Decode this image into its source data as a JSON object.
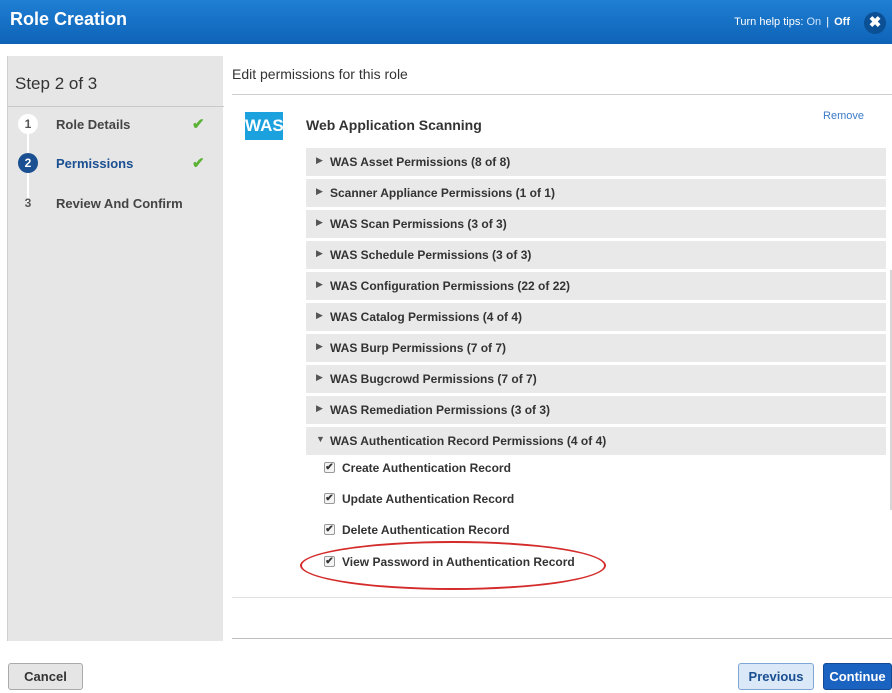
{
  "dialog": {
    "title": "Role Creation",
    "help_tips_label": "Turn help tips:",
    "help_on": "On",
    "help_separator": "|",
    "help_off": "Off",
    "close_glyph": "✖"
  },
  "steps_panel": {
    "header": "Step 2 of 3",
    "steps": [
      {
        "number": "1",
        "label": "Role Details",
        "status": "complete",
        "check": "✔"
      },
      {
        "number": "2",
        "label": "Permissions",
        "status": "current",
        "check": "✔"
      },
      {
        "number": "3",
        "label": "Review And Confirm",
        "status": "pending",
        "check": ""
      }
    ]
  },
  "main": {
    "heading": "Edit permissions for this role",
    "module": {
      "logo_text": "WAS",
      "title": "Web Application Scanning",
      "remove_label": "Remove"
    },
    "permission_groups": [
      {
        "label": "WAS Asset Permissions (8 of 8)",
        "expanded": false
      },
      {
        "label": "Scanner Appliance Permissions (1 of 1)",
        "expanded": false
      },
      {
        "label": "WAS Scan Permissions (3 of 3)",
        "expanded": false
      },
      {
        "label": "WAS Schedule Permissions (3 of 3)",
        "expanded": false
      },
      {
        "label": "WAS Configuration Permissions (22 of 22)",
        "expanded": false
      },
      {
        "label": "WAS Catalog Permissions (4 of 4)",
        "expanded": false
      },
      {
        "label": "WAS Burp Permissions (7 of 7)",
        "expanded": false
      },
      {
        "label": "WAS Bugcrowd Permissions (7 of 7)",
        "expanded": false
      },
      {
        "label": "WAS Remediation Permissions (3 of 3)",
        "expanded": false
      },
      {
        "label": "WAS Authentication Record Permissions (4 of 4)",
        "expanded": true
      }
    ],
    "collapsed_glyph": "▶",
    "expanded_glyph": "▼",
    "checkbox_glyph": "✔",
    "auth_record_permissions": [
      {
        "label": "Create Authentication Record",
        "checked": true
      },
      {
        "label": "Update Authentication Record",
        "checked": true
      },
      {
        "label": "Delete Authentication Record",
        "checked": true
      },
      {
        "label": "View Password in Authentication Record",
        "checked": true
      }
    ]
  },
  "footer": {
    "cancel_label": "Cancel",
    "previous_label": "Previous",
    "continue_label": "Continue"
  },
  "colors": {
    "titlebar": "#0e63b7",
    "was_logo": "#1ba1dd",
    "current_step": "#1a4f92",
    "check_green": "#5bb335",
    "highlight_red": "#d42b2b",
    "continue_button": "#1b63c0"
  }
}
